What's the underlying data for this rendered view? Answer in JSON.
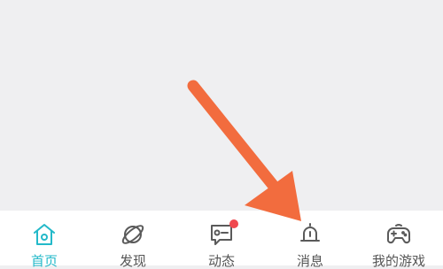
{
  "tabs": [
    {
      "label": "首页",
      "icon": "home-icon",
      "active": true
    },
    {
      "label": "发现",
      "icon": "planet-icon",
      "active": false
    },
    {
      "label": "动态",
      "icon": "chat-icon",
      "active": false,
      "badge": true
    },
    {
      "label": "消息",
      "icon": "bell-icon",
      "active": false
    },
    {
      "label": "我的游戏",
      "icon": "gamepad-icon",
      "active": false
    }
  ],
  "colors": {
    "accent": "#23b9c9",
    "badge": "#f0484e",
    "arrow": "#f26c3e",
    "inactive_icon": "#5a5a5a",
    "background": "#efeff1"
  }
}
